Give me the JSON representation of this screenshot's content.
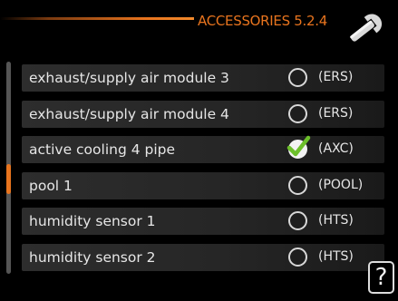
{
  "header": {
    "title": "ACCESSORIES 5.2.4",
    "icon": "wrench-icon",
    "accent_color": "#e8741e"
  },
  "scrollbar": {
    "position": 0.56,
    "visible_fraction": 0.14
  },
  "items": [
    {
      "label": "exhaust/supply air module 3",
      "code": "(ERS)",
      "checked": false
    },
    {
      "label": "exhaust/supply air module 4",
      "code": "(ERS)",
      "checked": false
    },
    {
      "label": "active cooling 4 pipe",
      "code": "(AXC)",
      "checked": true
    },
    {
      "label": "pool 1",
      "code": "(POOL)",
      "checked": false
    },
    {
      "label": "humidity sensor 1",
      "code": "(HTS)",
      "checked": false
    },
    {
      "label": "humidity sensor 2",
      "code": "(HTS)",
      "checked": false
    }
  ],
  "help": {
    "label": "?",
    "icon": "help-icon"
  }
}
